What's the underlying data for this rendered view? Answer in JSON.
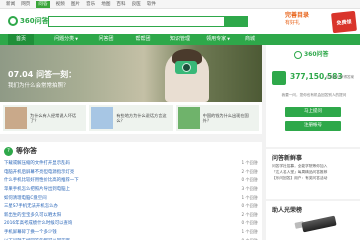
{
  "topnav": {
    "items": [
      "新闻",
      "网页",
      "问答",
      "视频",
      "图片",
      "音乐",
      "地图",
      "百科",
      "良医",
      "软件"
    ],
    "active_index": 2
  },
  "header": {
    "logo_text": "360问答",
    "promo_line1": "完善目录",
    "promo_line2": "有好礼",
    "promo_badge": "免费领"
  },
  "mainnav": {
    "items": [
      {
        "label": "首页",
        "active": true
      },
      {
        "label": "问题分类",
        "caret": true
      },
      {
        "label": "问答团"
      },
      {
        "label": "帮帮团"
      },
      {
        "label": "知识管理"
      },
      {
        "label": "领用专家",
        "caret": true
      },
      {
        "label": "商城"
      }
    ]
  },
  "hero": {
    "title": "07.04 问答一刻：",
    "subtitle": "我们为什么会常常拍照？"
  },
  "thumbs": [
    {
      "caption": "为什么有人经常说人坏话了？",
      "color": "#c9a98a"
    },
    {
      "caption": "有些地方为什么说话方言这么？",
      "color": "#a7c6e4"
    },
    {
      "caption": "中国的钱为什么出现在国外？",
      "color": "#6fb36b"
    }
  ],
  "questions": {
    "title": "等你答",
    "items": [
      {
        "q": "下载或解压缩的文件打开显示乱码",
        "c": "1 个回答"
      },
      {
        "q": "电脑开机后屏幕不亮但电源指示灯亮",
        "c": "2 个回答"
      },
      {
        "q": "什么手机比较好用性价比高的推荐一下",
        "c": "0 个回答"
      },
      {
        "q": "苹果手机怎么把照片导出到电脑上",
        "c": "3 个回答"
      },
      {
        "q": "如何清理电脑C盘空间",
        "c": "1 个回答"
      },
      {
        "q": "三星S7手机无法开机怎么办",
        "c": "0 个回答"
      },
      {
        "q": "新出生的宝宝多久可以晒太阳",
        "c": "2 个回答"
      },
      {
        "q": "2016年高考成绩什么时候可以查询",
        "c": "0 个回答"
      },
      {
        "q": "手机屏幕碎了换一个多少钱",
        "c": "1 个回答"
      },
      {
        "q": "以下问题未经回答的都可以回答哦",
        "c": "0 个回答"
      }
    ]
  },
  "rpanel": {
    "logo_text": "360问答",
    "count": "377,150,583",
    "count_sub": "位网友已获得答案",
    "desc": "我要一问，您你也有机会回答别人的提问",
    "ask_label": "马上提问",
    "register_label": "注册帐号"
  },
  "news": {
    "title": "问答新鲜事",
    "lines": [
      "问答学社招募，全能学院等你加入",
      "「达人名人堂」每周精品问答推荐",
      "【乐问回答】用户：有奖问答活动"
    ]
  },
  "product": {
    "title": "助人光荣榜"
  },
  "colors": {
    "brand_green": "#2ea84a",
    "link_blue": "#2a66b8",
    "promo_orange": "#e8641b"
  }
}
